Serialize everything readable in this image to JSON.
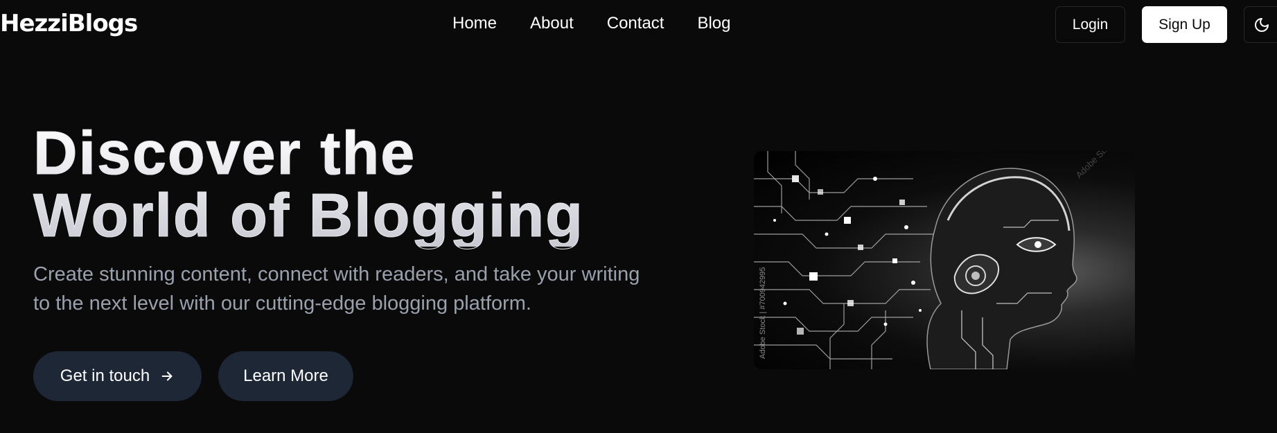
{
  "brand": {
    "name": "HezziBlogs"
  },
  "nav": {
    "links": [
      {
        "label": "Home"
      },
      {
        "label": "About"
      },
      {
        "label": "Contact"
      },
      {
        "label": "Blog"
      }
    ]
  },
  "auth": {
    "login_label": "Login",
    "signup_label": "Sign Up"
  },
  "theme_toggle": {
    "icon": "moon-icon"
  },
  "hero": {
    "title_line1": "Discover the",
    "title_line2": "World of Blogging",
    "subtitle": "Create stunning content, connect with readers, and take your writing to the next level with our cutting-edge blogging platform.",
    "cta_primary": {
      "label": "Get in touch",
      "icon": "arrow-right-icon"
    },
    "cta_secondary": {
      "label": "Learn More"
    },
    "image": {
      "subject": "robot-head-circuit-illustration",
      "watermark_id": "Adobe Stock | #700942995",
      "watermark": "Adobe Stock"
    }
  },
  "colors": {
    "background": "#0a0a0b",
    "button_dark": "#1e2736",
    "subtitle": "#9aa1ad",
    "signup_bg": "#ffffff"
  }
}
